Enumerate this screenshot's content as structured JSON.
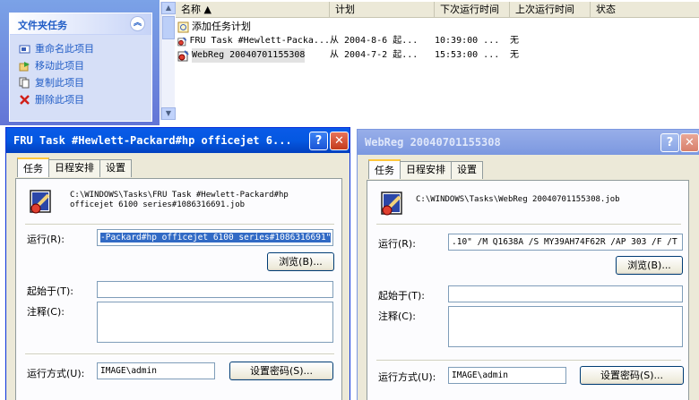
{
  "taskpane": {
    "title": "文件夹任务",
    "toggle": "︽",
    "items": [
      {
        "label": "重命名此项目",
        "icon": "rename-icon"
      },
      {
        "label": "移动此项目",
        "icon": "move-icon"
      },
      {
        "label": "复制此项目",
        "icon": "copy-icon"
      },
      {
        "label": "删除此项目",
        "icon": "delete-icon"
      }
    ]
  },
  "list": {
    "columns": [
      "名称 ▲",
      "计划",
      "下次运行时间",
      "上次运行时间",
      "状态"
    ],
    "rows": [
      {
        "name": "添加任务计划",
        "schedule": "",
        "next": "",
        "last": "",
        "status": "",
        "icon": "add-task-icon"
      },
      {
        "name": "FRU Task #Hewlett-Packa...",
        "schedule": "从 2004-8-6 起...",
        "next": "10:39:00  ...",
        "last": "无",
        "status": "",
        "icon": "scheduled-task-icon"
      },
      {
        "name": "WebReg 20040701155308",
        "schedule": "从 2004-7-2 起...",
        "next": "15:53:00  ...",
        "last": "无",
        "status": "",
        "icon": "scheduled-task-icon"
      }
    ]
  },
  "dialog1": {
    "title": "FRU Task #Hewlett-Packard#hp officejet 6...",
    "tabs": [
      "任务",
      "日程安排",
      "设置"
    ],
    "path_line1": "C:\\WINDOWS\\Tasks\\FRU Task #Hewlett-Packard#hp",
    "path_line2": "officejet 6100 series#1086316691.job",
    "run_label": "运行(R):",
    "run_value": "-Packard#hp officejet 6100 series#1086316691\"",
    "browse": "浏览(B)...",
    "start_label": "起始于(T):",
    "start_value": "",
    "comment_label": "注释(C):",
    "runas_label": "运行方式(U):",
    "runas_value": "IMAGE\\admin",
    "setpw": "设置密码(S)..."
  },
  "dialog2": {
    "title": "WebReg 20040701155308",
    "tabs": [
      "任务",
      "日程安排",
      "设置"
    ],
    "path_line1": "C:\\WINDOWS\\Tasks\\WebReg 20040701155308.job",
    "run_label": "运行(R):",
    "run_value": ".10\" /M Q1638A /S MY39AH74F62R /AP 303 /F  /T",
    "browse": "浏览(B)...",
    "start_label": "起始于(T):",
    "start_value": "",
    "comment_label": "注释(C):",
    "runas_label": "运行方式(U):",
    "runas_value": "IMAGE\\admin",
    "setpw": "设置密码(S)..."
  },
  "colors": {
    "xp_blue": "#0a5ae8",
    "taskpane_link": "#215dc6",
    "selection": "#316ac5",
    "dialog_face": "#ece9d8"
  }
}
